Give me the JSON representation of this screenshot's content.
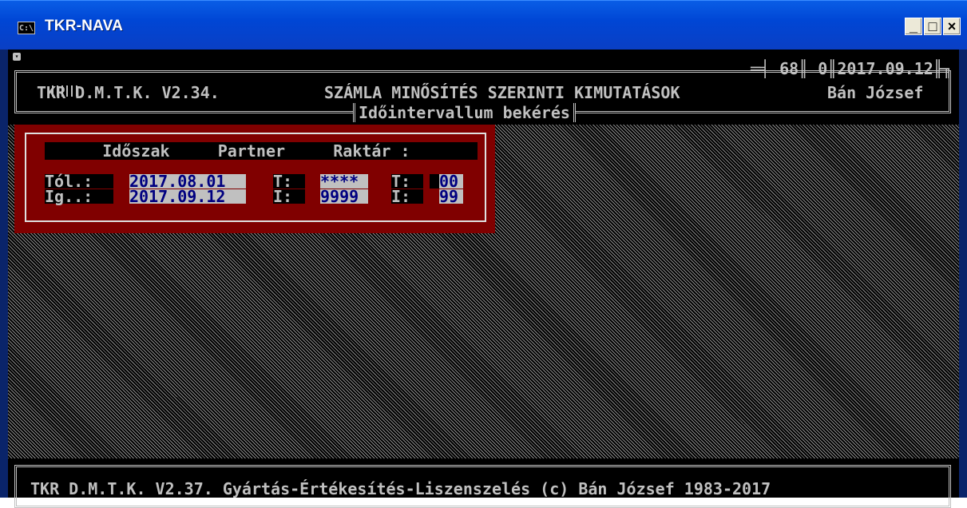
{
  "window": {
    "title": "TKR-NAVA",
    "icon_text": "C:\\",
    "buttons": {
      "minimize": "_",
      "maximize": "□",
      "close": "×"
    }
  },
  "header": {
    "app_version": "TKR D.M.T.K. V2.34.",
    "title": "SZÁMLA MINŐSÍTÉS SZERINTI KIMUTATÁSOK",
    "counters": "═╡ 68║ 0║2017.09.12╟╖",
    "user": "Bán József",
    "subtitle": "Időintervallum bekérés"
  },
  "dialog": {
    "header": "      Időszak     Partner     Raktár :",
    "from_label": "Tól.:",
    "to_label": "Ig..:",
    "date_from": "2017.08.01",
    "date_to": "2017.09.12",
    "partner_from_label": "T:",
    "partner_to_label": "I:",
    "partner_from": "****",
    "partner_to": "9999",
    "store_from_label": "T:",
    "store_to_label": "I:",
    "store_from": "00",
    "store_to": "99"
  },
  "footer": {
    "text": "TKR D.M.T.K. V2.37. Gyártás-Értékesítés-Liszenszelés (c) Bán József 1983-2017"
  },
  "colors": {
    "titlebar": "#0046d5",
    "console_bg": "#000000",
    "console_fg": "#c0c0c0",
    "dialog_bg": "#800000",
    "field_bg": "#c0c0c0",
    "field_fg": "#000080"
  }
}
